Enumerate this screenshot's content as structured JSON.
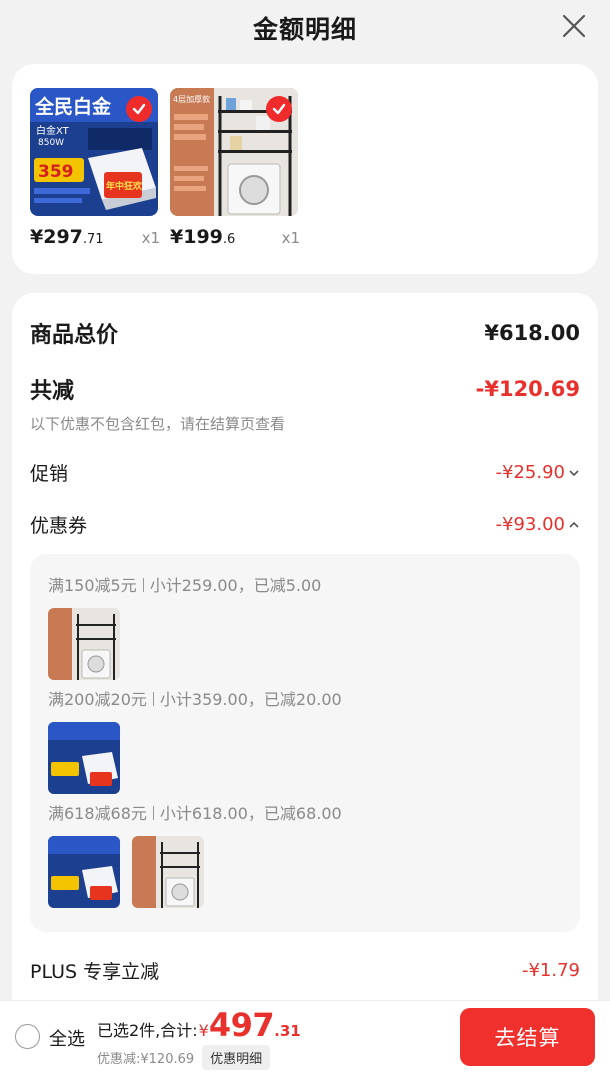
{
  "header": {
    "title": "金额明细"
  },
  "products": [
    {
      "price_int": "¥297",
      "price_dec": ".71",
      "qty": "x1",
      "thumb_text": {
        "banner": "全民白金",
        "model": "白金XT",
        "watt": "850W",
        "price": "359",
        "tag": "年中狂欢"
      }
    },
    {
      "price_int": "¥199",
      "price_dec": ".6",
      "qty": "x1",
      "thumb_text": {
        "banner": "4层加厚款"
      }
    }
  ],
  "summary_rows": {
    "total_label": "商品总价",
    "total_value": "¥618.00",
    "reduce_label": "共减",
    "reduce_value": "-¥120.69",
    "note": "以下优惠不包含红包，请在结算页查看",
    "promo_label": "促销",
    "promo_value": "-¥25.90",
    "coupon_label": "优惠券",
    "coupon_value": "-¥93.00",
    "plus_label": "PLUS 专享立减",
    "plus_value": "-¥1.79"
  },
  "coupons": [
    {
      "rule": "满150减5元",
      "detail": "小计259.00，已减5.00"
    },
    {
      "rule": "满200减20元",
      "detail": "小计359.00，已减20.00"
    },
    {
      "rule": "满618减68元",
      "detail": "小计618.00，已减68.00"
    }
  ],
  "bottom_bar": {
    "select_all": "全选",
    "selected_text": "已选2件,合计:",
    "total_yen": "¥",
    "total_int": "497",
    "total_dec": ".31",
    "discount_text": "优惠减:¥120.69",
    "detail_chip": "优惠明细",
    "checkout": "去结算"
  },
  "colors": {
    "accent": "#e8312d",
    "button": "#f0302d"
  }
}
